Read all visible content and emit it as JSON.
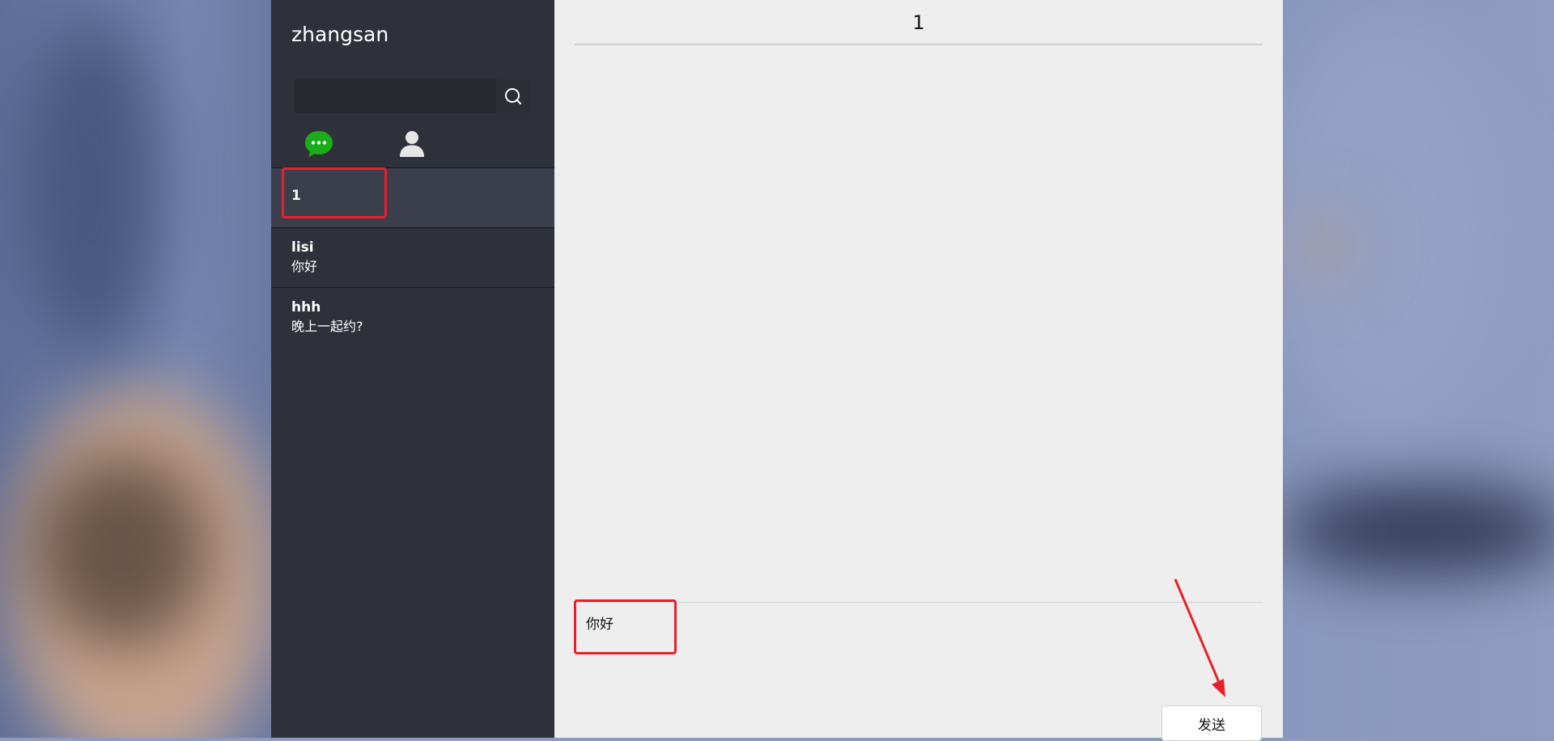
{
  "user": {
    "name": "zhangsan"
  },
  "search": {
    "placeholder": "",
    "value": ""
  },
  "nav": {
    "chat_icon": "chat-bubble-icon",
    "contacts_icon": "person-icon",
    "accent": "#1aad19"
  },
  "chats": [
    {
      "name": "1",
      "preview": "",
      "active": true
    },
    {
      "name": "lisi",
      "preview": "你好",
      "active": false
    },
    {
      "name": "hhh",
      "preview": "晚上一起约?",
      "active": false
    }
  ],
  "conversation": {
    "title": "1"
  },
  "composer": {
    "value": "你好"
  },
  "send_button": {
    "label": "发送"
  },
  "annotation_color": "#e8202a"
}
